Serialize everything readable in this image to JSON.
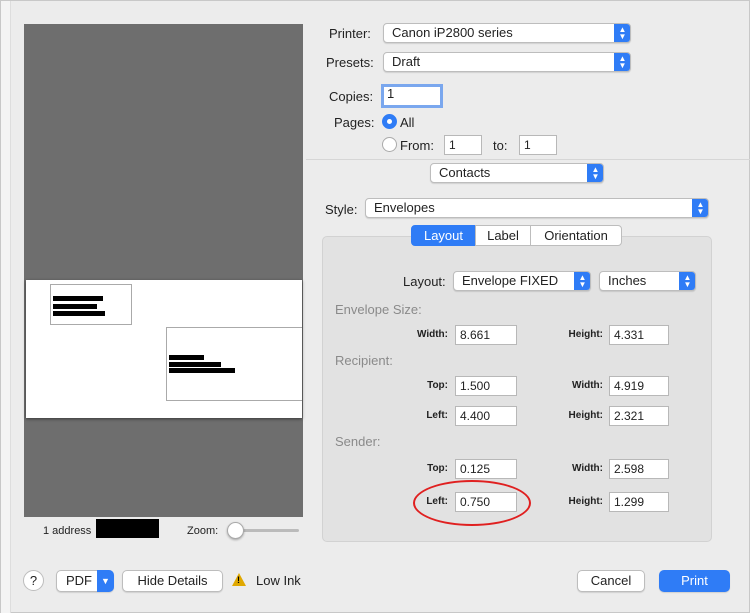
{
  "printer": {
    "label": "Printer:",
    "value": "Canon iP2800 series"
  },
  "presets": {
    "label": "Presets:",
    "value": "Draft"
  },
  "copies": {
    "label": "Copies:",
    "value": "1"
  },
  "pages": {
    "label": "Pages:",
    "all_label": "All",
    "from_label": "From:",
    "from_value": "1",
    "to_label": "to:",
    "to_value": "1"
  },
  "app_popup": {
    "value": "Contacts"
  },
  "style": {
    "label": "Style:",
    "value": "Envelopes"
  },
  "tabs": [
    {
      "label": "Layout"
    },
    {
      "label": "Label"
    },
    {
      "label": "Orientation"
    }
  ],
  "layout": {
    "label": "Layout:",
    "value": "Envelope FIXED",
    "units": "Inches"
  },
  "envelope_size": {
    "title": "Envelope Size:",
    "width_label": "Width:",
    "width": "8.661",
    "height_label": "Height:",
    "height": "4.331"
  },
  "recipient": {
    "title": "Recipient:",
    "top_label": "Top:",
    "top": "1.500",
    "width_label": "Width:",
    "width": "4.919",
    "left_label": "Left:",
    "left": "4.400",
    "height_label": "Height:",
    "height": "2.321"
  },
  "sender": {
    "title": "Sender:",
    "top_label": "Top:",
    "top": "0.125",
    "width_label": "Width:",
    "width": "2.598",
    "left_label": "Left:",
    "left": "0.750",
    "height_label": "Height:",
    "height": "1.299"
  },
  "preview": {
    "address_count": "1 address",
    "zoom_label": "Zoom:"
  },
  "footer": {
    "help": "?",
    "pdf": "PDF",
    "hide_details": "Hide Details",
    "low_ink": "Low Ink",
    "cancel": "Cancel",
    "print": "Print"
  },
  "colors": {
    "accent": "#2f7cf6",
    "annotation": "#e02020",
    "warning": "#e0a800"
  }
}
